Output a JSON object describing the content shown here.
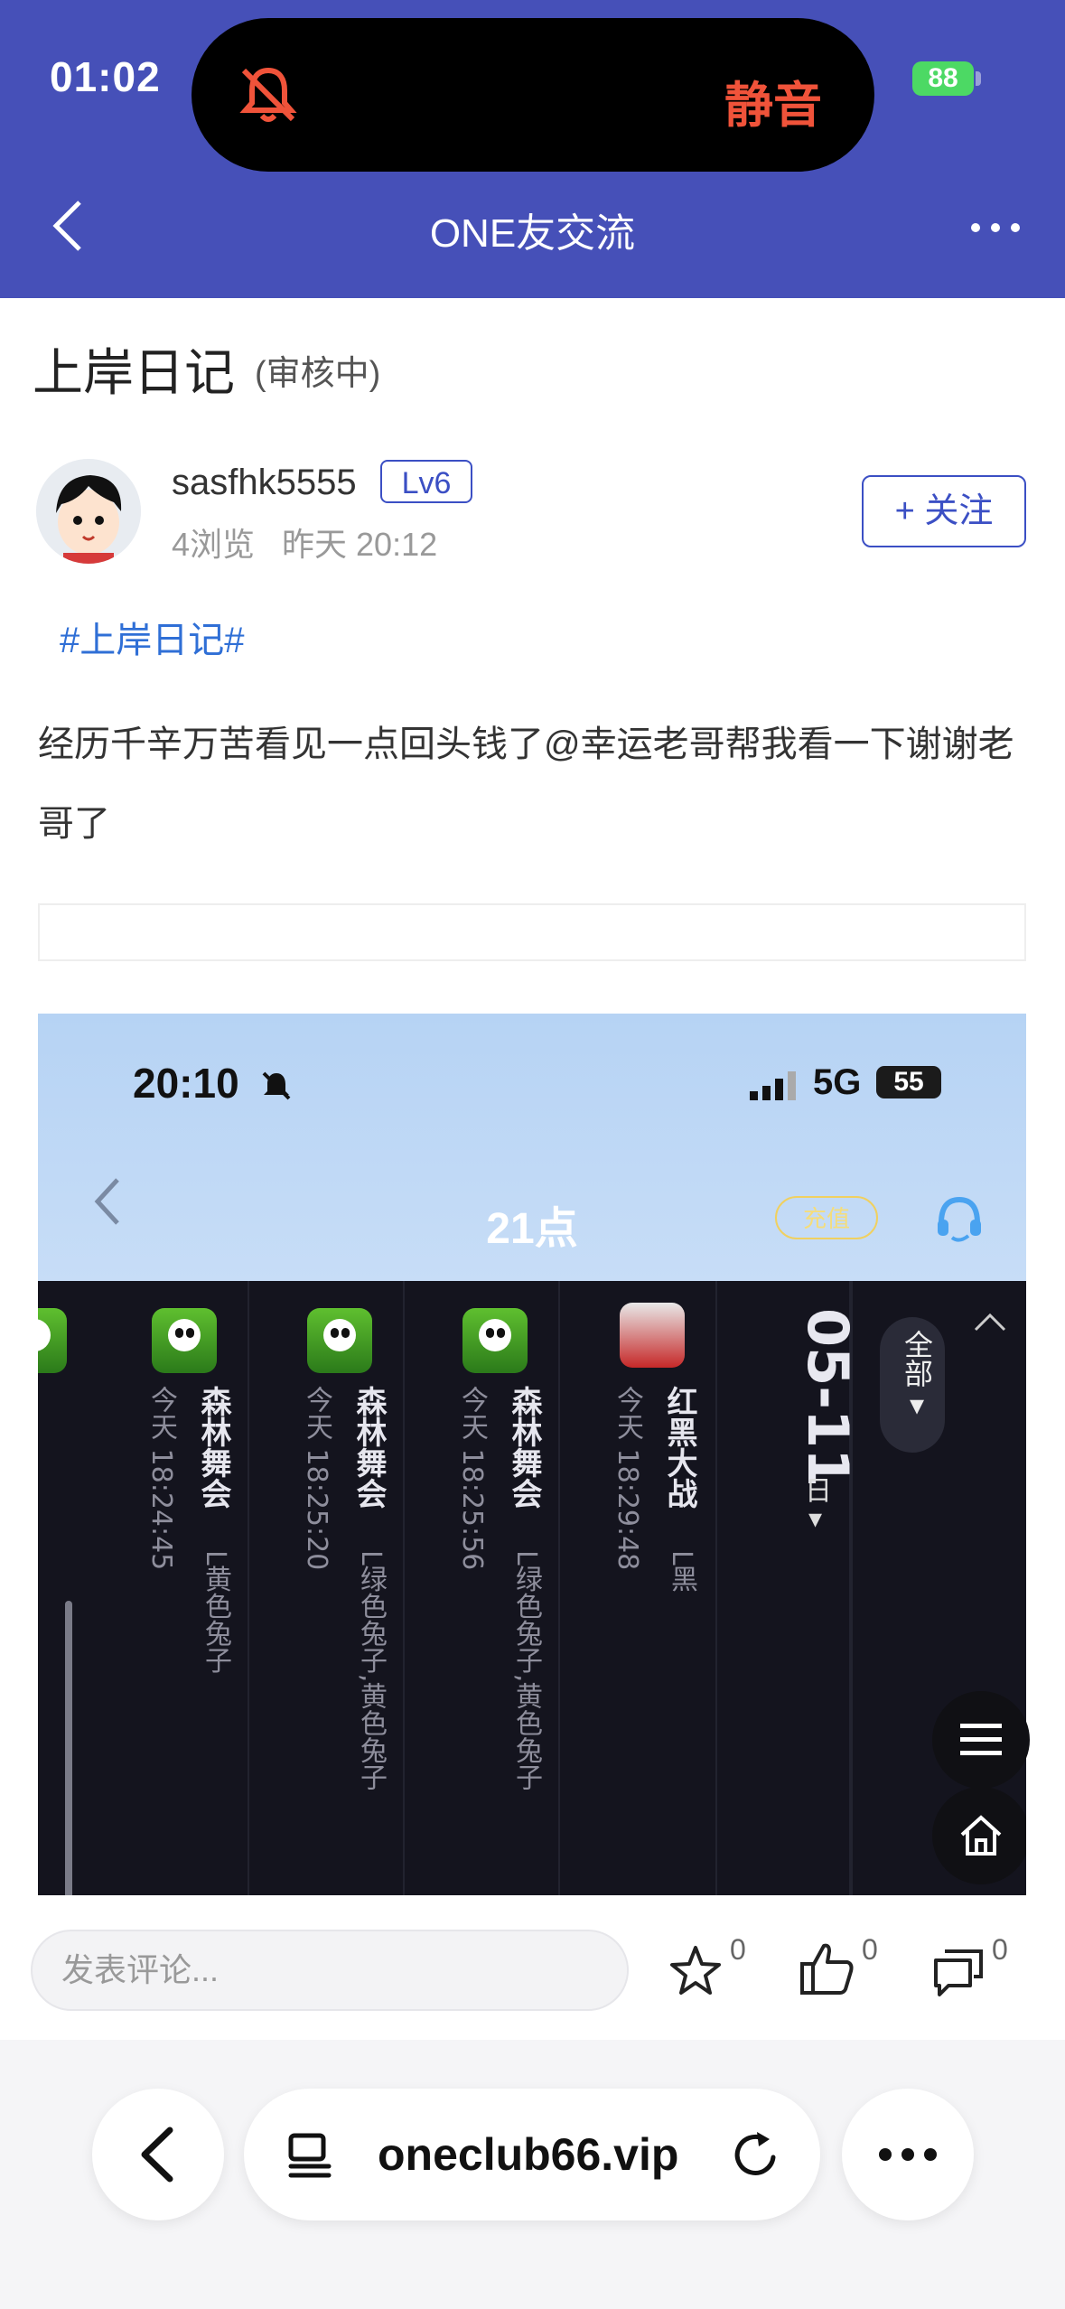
{
  "status_bar": {
    "time": "01:02",
    "mute_label": "静音",
    "battery": "88"
  },
  "nav": {
    "title": "ONE友交流"
  },
  "post": {
    "title": "上岸日记",
    "status": "(审核中)",
    "author": {
      "name": "sasfhk5555",
      "level": "Lv6",
      "views": "4浏览",
      "time": "昨天 20:12"
    },
    "follow_label": "+ 关注",
    "hashtag": "#上岸日记#",
    "content": "经历千辛万苦看见一点回头钱了@幸运老哥帮我看一下谢谢老哥了"
  },
  "embedded_screenshot": {
    "time": "20:10",
    "network": "5G",
    "battery": "55",
    "title": "21点",
    "recharge_label": "充值",
    "date_label": "05-11",
    "date_suffix": "日▾",
    "filter_label": "全部▾",
    "records": [
      {
        "name": "红黑大战",
        "detail": "L黑",
        "time": "今天 18:29:48",
        "icon": "red-black-icon"
      },
      {
        "name": "森林舞会",
        "detail": "L绿色兔子,黄色兔子",
        "time": "今天 18:25:56",
        "icon": "panda-icon"
      },
      {
        "name": "森林舞会",
        "detail": "L绿色兔子,黄色兔子",
        "time": "今天 18:25:20",
        "icon": "panda-icon"
      },
      {
        "name": "森林舞会",
        "detail": "L黄色兔子",
        "time": "今天 18:24:45",
        "icon": "panda-icon"
      }
    ]
  },
  "comment_bar": {
    "placeholder": "发表评论...",
    "favorites": "0",
    "likes": "0",
    "comments": "0"
  },
  "browser": {
    "url": "oneclub66.vip"
  },
  "colors": {
    "header_bg": "#4650b8",
    "accent": "#3b4fc4",
    "hashtag": "#2f6fd6",
    "mute_red": "#f0533a"
  }
}
